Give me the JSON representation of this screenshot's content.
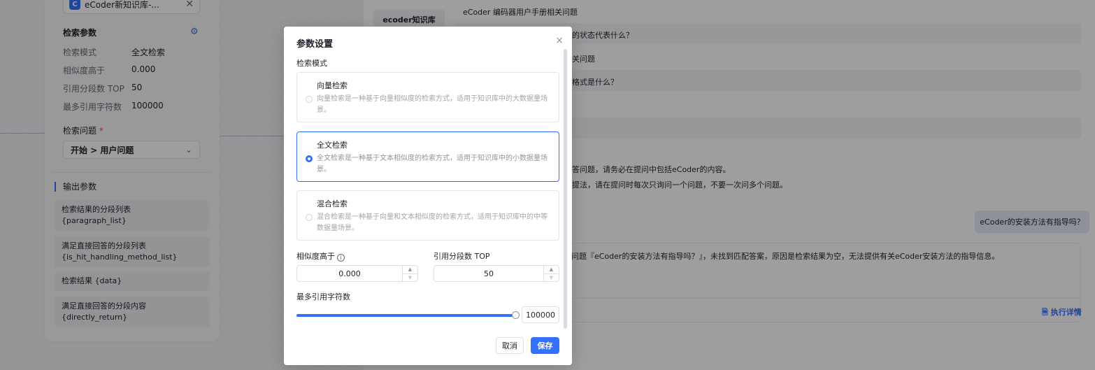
{
  "left_node": {
    "kb_logo": "C",
    "kb_name": "eCoder新知识库-...",
    "kb_close": "✕",
    "search_params_title": "检索参数",
    "params": [
      {
        "key": "检索模式",
        "value": "全文检索"
      },
      {
        "key": "相似度高于",
        "value": "0.000"
      },
      {
        "key": "引用分段数 TOP",
        "value": "50"
      },
      {
        "key": "最多引用字符数",
        "value": "100000"
      }
    ],
    "question_label": "检索问题",
    "required_mark": "*",
    "question_value": "开始 > 用户问题",
    "output_title": "输出参数",
    "outputs": [
      {
        "name": "检索结果的分段列表",
        "var": "{paragraph_list}"
      },
      {
        "name": "满足直接回答的分段列表",
        "var": "{is_hit_handling_method_list}"
      },
      {
        "name": "检索结果",
        "var": "{data}"
      },
      {
        "name": "满足直接回答的分段内容",
        "var": "{directly_return}"
      }
    ]
  },
  "middle": {
    "tab_label": "ecoder知识库"
  },
  "chat": {
    "lines": [
      "eCoder 编码器用户手册相关问题",
      "的状态代表什么？",
      "关问题",
      "格式是什么？",
      "答问题，请务必在提问中包括eCoder的内容。",
      "提法，请在提问时每次只询问一个问题，不要一次问多个问题。"
    ],
    "user_question": "eCoder的安装方法有指导吗？",
    "answer": "问题『eCoder的安装方法有指导吗？』，未找到匹配答案，原因是检索结果为空，无法提供有关eCoder安装方法的指导信息。",
    "detail_link": "执行详情"
  },
  "modal": {
    "title": "参数设置",
    "close": "×",
    "mode_label": "检索模式",
    "options": [
      {
        "title": "向量检索",
        "desc": "向量检索是一种基于向量相似度的检索方式，适用于知识库中的大数据量场景。",
        "selected": false
      },
      {
        "title": "全文检索",
        "desc": "全文检索是一种基于文本相似度的检索方式，适用于知识库中的小数据量场景。",
        "selected": true
      },
      {
        "title": "混合检索",
        "desc": "混合检索是一种基于向量和文本相似度的检索方式，适用于知识库中的中等数据量场景。",
        "selected": false
      }
    ],
    "similarity_label": "相似度高于",
    "similarity_value": "0.000",
    "top_label": "引用分段数 TOP",
    "top_value": "50",
    "max_chars_label": "最多引用字符数",
    "max_chars_value": "100000",
    "slider_fraction": 1.0,
    "cancel_label": "取消",
    "save_label": "保存",
    "accent_color": "#3370ff"
  }
}
